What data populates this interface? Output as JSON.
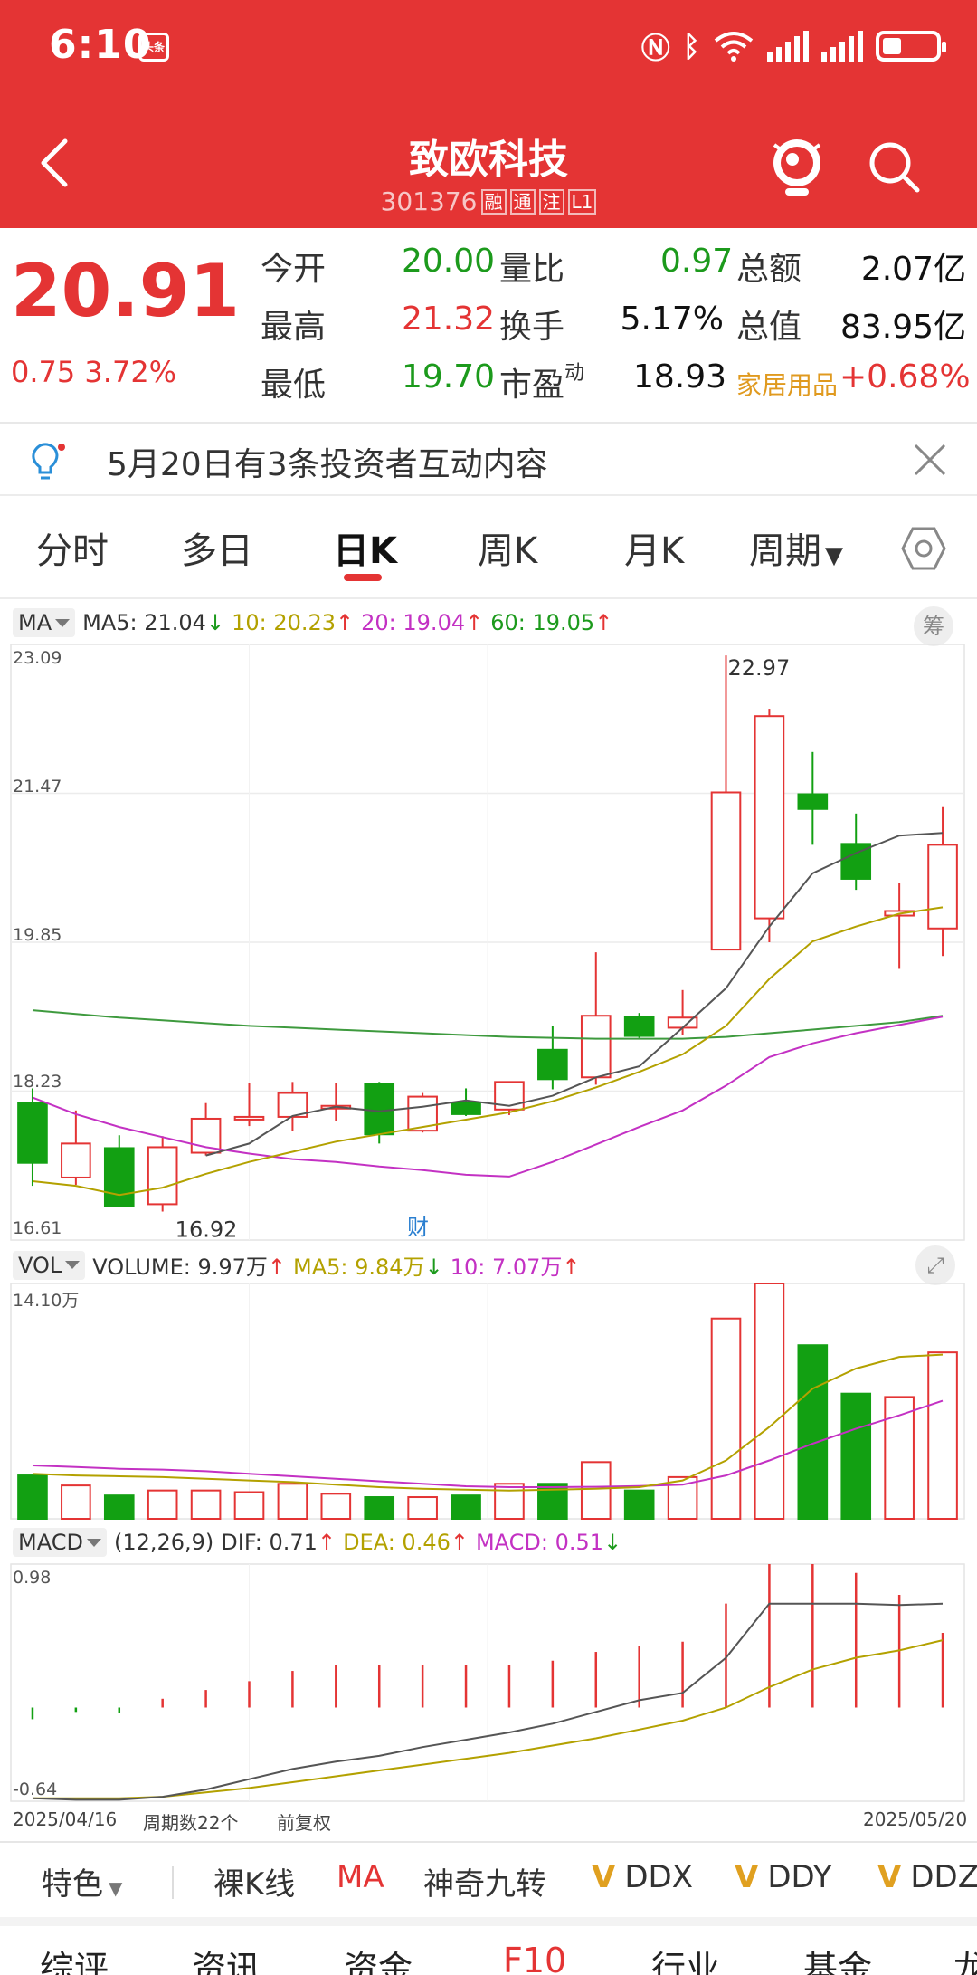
{
  "status_bar": {
    "time": "6:10",
    "badge": "头条"
  },
  "header": {
    "title": "致欧科技",
    "code": "301376",
    "tags": [
      "融",
      "通",
      "注",
      "L1"
    ]
  },
  "quote": {
    "price": "20.91",
    "change": "0.75",
    "change_pct": "3.72%",
    "rows": [
      [
        {
          "label": "今开",
          "value": "20.00"
        },
        {
          "label": "量比",
          "value": "0.97"
        },
        {
          "label": "总额",
          "value": "2.07亿"
        }
      ],
      [
        {
          "label": "最高",
          "value": "21.32"
        },
        {
          "label": "换手",
          "value": "5.17%"
        },
        {
          "label": "总值",
          "value": "83.95亿"
        }
      ],
      [
        {
          "label": "最低",
          "value": "19.70"
        },
        {
          "label": "市盈",
          "sup": "动",
          "value": "18.93"
        },
        {
          "label": "家居用品",
          "value": "+0.68%"
        }
      ]
    ]
  },
  "notice": {
    "text": "5月20日有3条投资者互动内容"
  },
  "tabs": [
    {
      "label": "分时"
    },
    {
      "label": "多日"
    },
    {
      "label": "日K",
      "active": true
    },
    {
      "label": "周K"
    },
    {
      "label": "月K"
    },
    {
      "label": "周期"
    }
  ],
  "kline": {
    "indicator": "MA",
    "ma5": "MA5: 21.04",
    "ma10": "10: 20.23",
    "ma20": "20: 19.04",
    "ma60": "60: 19.05",
    "chip_label": "筹",
    "yticks": [
      "23.09",
      "21.47",
      "19.85",
      "18.23",
      "16.61"
    ],
    "high_label": "22.97",
    "low_label": "16.92",
    "marker": "财"
  },
  "volume": {
    "indicator": "VOL",
    "volume": "VOLUME: 9.97万",
    "ma5": "MA5: 9.84万",
    "ma10": "10: 7.07万",
    "ymax": "14.10万"
  },
  "macd": {
    "indicator": "MACD",
    "params": "(12,26,9)",
    "dif": "DIF: 0.71",
    "dea": "DEA: 0.46",
    "macd": "MACD: 0.51",
    "ymax": "0.98",
    "ymin": "-0.64"
  },
  "footer_info": {
    "start": "2025/04/16",
    "period": "周期数22个",
    "adjust": "前复权",
    "end": "2025/05/20"
  },
  "toolbar": {
    "special": "特色",
    "items": [
      "裸K线",
      "MA",
      "神奇九转",
      "DDX",
      "DDY",
      "DDZ"
    ]
  },
  "bottom_tabs": [
    "综评",
    "资讯",
    "资金",
    "F10",
    "行业",
    "基金",
    "龙"
  ],
  "chart_data": {
    "type": "candlestick",
    "x_range": [
      "2025/04/16",
      "2025/05/20"
    ],
    "ylim": [
      16.61,
      23.09
    ],
    "candles": [
      {
        "open": 18.1,
        "close": 17.45,
        "high": 18.26,
        "low": 17.2
      },
      {
        "open": 17.29,
        "close": 17.66,
        "high": 18.02,
        "low": 17.21
      },
      {
        "open": 17.61,
        "close": 16.98,
        "high": 17.75,
        "low": 16.98
      },
      {
        "open": 17.0,
        "close": 17.62,
        "high": 17.74,
        "low": 16.92
      },
      {
        "open": 17.56,
        "close": 17.93,
        "high": 18.1,
        "low": 17.53
      },
      {
        "open": 17.93,
        "close": 17.95,
        "high": 18.32,
        "low": 17.85
      },
      {
        "open": 17.95,
        "close": 18.21,
        "high": 18.33,
        "low": 17.8
      },
      {
        "open": 18.06,
        "close": 18.07,
        "high": 18.32,
        "low": 17.9
      },
      {
        "open": 18.31,
        "close": 17.76,
        "high": 18.33,
        "low": 17.66
      },
      {
        "open": 17.8,
        "close": 18.17,
        "high": 18.21,
        "low": 17.78
      },
      {
        "open": 18.1,
        "close": 17.98,
        "high": 18.26,
        "low": 17.96
      },
      {
        "open": 18.03,
        "close": 18.33,
        "high": 18.33,
        "low": 17.97
      },
      {
        "open": 18.68,
        "close": 18.36,
        "high": 18.94,
        "low": 18.25
      },
      {
        "open": 18.38,
        "close": 19.05,
        "high": 19.74,
        "low": 18.3
      },
      {
        "open": 19.04,
        "close": 18.83,
        "high": 19.08,
        "low": 18.81
      },
      {
        "open": 18.92,
        "close": 19.03,
        "high": 19.33,
        "low": 18.84
      },
      {
        "open": 19.77,
        "close": 21.48,
        "high": 22.97,
        "low": 19.77
      },
      {
        "open": 20.11,
        "close": 22.31,
        "high": 22.39,
        "low": 19.85
      },
      {
        "open": 21.46,
        "close": 21.3,
        "high": 21.92,
        "low": 20.91
      },
      {
        "open": 20.92,
        "close": 20.54,
        "high": 21.25,
        "low": 20.42
      },
      {
        "open": 20.14,
        "close": 20.19,
        "high": 20.49,
        "low": 19.56
      },
      {
        "open": 20.0,
        "close": 20.91,
        "high": 21.32,
        "low": 19.7
      }
    ],
    "ma5": [
      null,
      null,
      null,
      null,
      17.53,
      17.66,
      17.96,
      18.06,
      18.01,
      18.06,
      18.13,
      18.07,
      18.18,
      18.38,
      18.5,
      18.92,
      19.35,
      20.02,
      20.6,
      20.82,
      21.01,
      21.04
    ],
    "ma10": [
      17.25,
      17.2,
      17.1,
      17.18,
      17.33,
      17.46,
      17.57,
      17.68,
      17.76,
      17.84,
      17.92,
      18.0,
      18.12,
      18.27,
      18.44,
      18.63,
      18.94,
      19.45,
      19.86,
      20.02,
      20.16,
      20.23
    ],
    "ma20": [
      18.16,
      17.98,
      17.84,
      17.73,
      17.62,
      17.55,
      17.49,
      17.46,
      17.41,
      17.37,
      17.32,
      17.3,
      17.46,
      17.65,
      17.84,
      18.02,
      18.29,
      18.6,
      18.75,
      18.86,
      18.95,
      19.04
    ],
    "ma60": [
      19.11,
      19.07,
      19.03,
      19.0,
      18.97,
      18.94,
      18.92,
      18.9,
      18.88,
      18.86,
      18.84,
      18.82,
      18.81,
      18.8,
      18.8,
      18.8,
      18.82,
      18.86,
      18.9,
      18.94,
      18.98,
      19.05
    ],
    "volume": {
      "ylim": [
        0,
        14.1
      ],
      "values": [
        2.6,
        2.0,
        1.4,
        1.7,
        1.7,
        1.6,
        2.1,
        1.5,
        1.3,
        1.3,
        1.4,
        2.1,
        2.1,
        3.4,
        1.7,
        2.5,
        12.0,
        14.1,
        10.4,
        7.5,
        7.3,
        9.97
      ],
      "ma5": [
        2.7,
        2.6,
        2.55,
        2.5,
        2.4,
        2.3,
        2.2,
        2.05,
        1.9,
        1.8,
        1.75,
        1.7,
        1.75,
        1.8,
        1.9,
        2.3,
        3.5,
        5.5,
        7.8,
        9.0,
        9.7,
        9.84
      ],
      "ma10": [
        3.2,
        3.1,
        3.0,
        2.95,
        2.85,
        2.7,
        2.55,
        2.4,
        2.25,
        2.1,
        1.95,
        1.9,
        1.9,
        1.92,
        1.97,
        2.05,
        2.6,
        3.5,
        4.5,
        5.4,
        6.2,
        7.07
      ]
    },
    "macd": {
      "ylim": [
        -0.64,
        0.98
      ],
      "dif": [
        -0.62,
        -0.63,
        -0.63,
        -0.61,
        -0.56,
        -0.49,
        -0.42,
        -0.37,
        -0.33,
        -0.27,
        -0.22,
        -0.17,
        -0.11,
        -0.03,
        0.05,
        0.1,
        0.34,
        0.71,
        0.71,
        0.71,
        0.7,
        0.71
      ],
      "dea": [
        -0.62,
        -0.62,
        -0.62,
        -0.61,
        -0.58,
        -0.55,
        -0.51,
        -0.47,
        -0.43,
        -0.39,
        -0.35,
        -0.31,
        -0.26,
        -0.21,
        -0.15,
        -0.09,
        0.0,
        0.14,
        0.26,
        0.34,
        0.39,
        0.46
      ],
      "hist": [
        -0.08,
        -0.03,
        -0.04,
        0.06,
        0.12,
        0.18,
        0.25,
        0.29,
        0.29,
        0.29,
        0.29,
        0.29,
        0.32,
        0.38,
        0.42,
        0.45,
        0.71,
        0.98,
        0.98,
        0.92,
        0.77,
        0.51
      ]
    }
  }
}
